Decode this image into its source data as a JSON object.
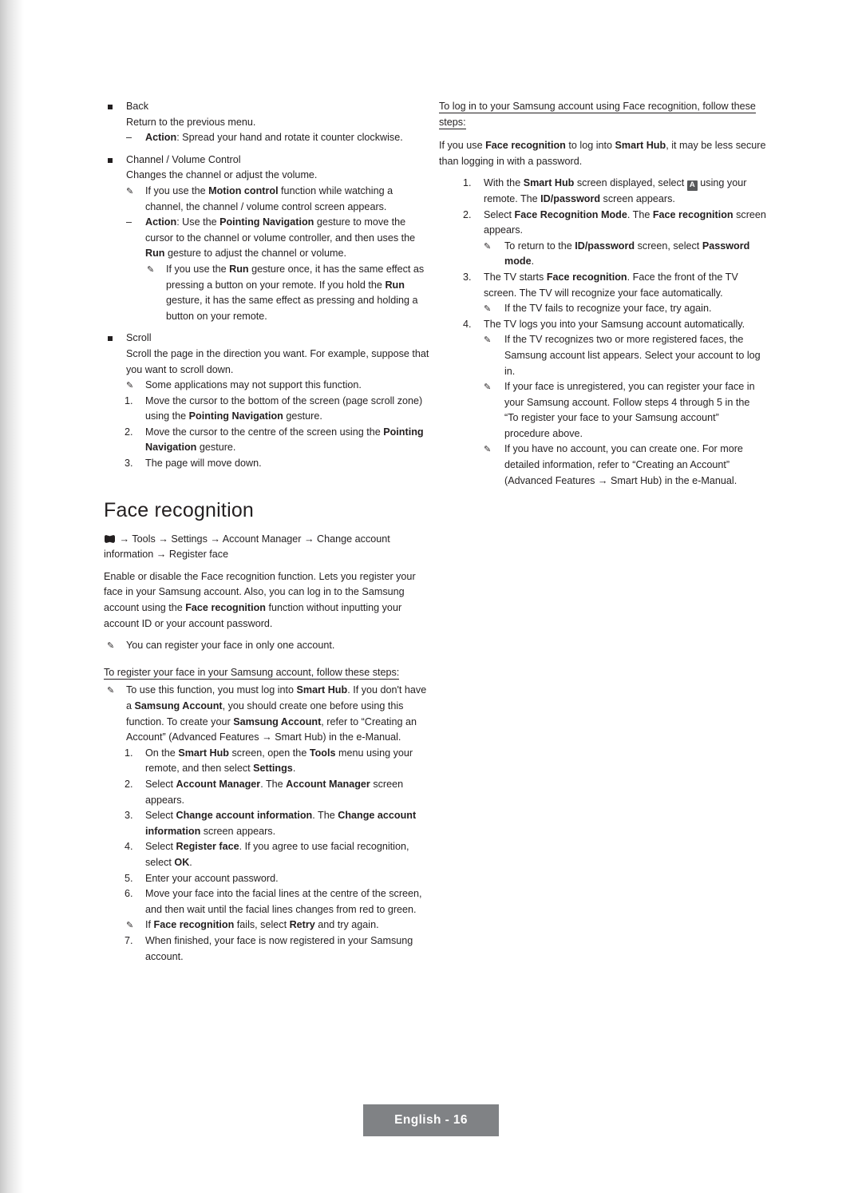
{
  "document": {
    "footer_label": "English - 16",
    "section_title": "Face recognition"
  },
  "left_column": {
    "items": [
      {
        "type": "square",
        "text": "Back"
      },
      {
        "type": "indent1",
        "text": "Return to the previous menu."
      },
      {
        "type": "dash",
        "bold_lead": "Action",
        "text": ": Spread your hand and rotate it counter clockwise."
      },
      {
        "type": "square",
        "text": "Channel / Volume Control"
      },
      {
        "type": "indent1",
        "text": "Changes the channel or adjust the volume."
      },
      {
        "type": "note",
        "text": "If you use the Motion control function while watching a channel, the channel / volume control screen appears."
      },
      {
        "type": "dash",
        "bold_lead": "Action",
        "text": ": Use the Pointing Navigation gesture to move the cursor to the channel or volume controller, and then uses the Run gesture to adjust the channel or volume."
      },
      {
        "type": "note-deep",
        "text": "If you use the Run gesture once, it has the same effect as pressing a button on your remote. If you hold the Run gesture, it has the same effect as pressing and holding a button on your remote."
      },
      {
        "type": "square",
        "text": "Scroll"
      },
      {
        "type": "indent1",
        "text": "Scroll the page in the direction you want. For example, suppose that you want to scroll down."
      },
      {
        "type": "note",
        "text": "Some applications may not support this function."
      },
      {
        "type": "num",
        "n": "1.",
        "text": "Move the cursor to the bottom of the screen (page scroll zone) using the Pointing Navigation gesture."
      },
      {
        "type": "num",
        "n": "2.",
        "text": "Move the cursor to the centre of the screen using the Pointing Navigation gesture."
      },
      {
        "type": "num",
        "n": "3.",
        "text": "The page will move down."
      }
    ],
    "face_recognition": {
      "title": "Face recognition",
      "menu_path": "→ Tools → Settings → Account Manager → Change account information → Register face",
      "intro": "Enable or disable the Face recognition function. Lets you register your face in your Samsung account. Also, you can log in to the Samsung account using the Face recognition function without inputting your account ID or your account password.",
      "note_one_account": "You can register your face in only one account.",
      "register_heading": "To register your face in your Samsung account, follow these steps:",
      "register_note": "To use this function, you must log into Smart Hub. If you don't have a Samsung Account, you should create one before using this function. To create your Samsung Account, refer to “Creating an Account” (Advanced Features → Smart Hub) in the e-Manual.",
      "steps": [
        {
          "n": "1.",
          "text": "On the Smart Hub screen, open the Tools menu using your remote, and then select Settings."
        },
        {
          "n": "2.",
          "text": "Select Account Manager. The Account Manager screen appears."
        },
        {
          "n": "3.",
          "text": "Select Change account information. The Change account information screen appears."
        },
        {
          "n": "4.",
          "text": "Select Register face. If you agree to use facial recognition, select OK."
        },
        {
          "n": "5.",
          "text": "Enter your account password."
        },
        {
          "n": "6.",
          "text": "Move your face into the facial lines at the centre of the screen, and then wait until the facial lines changes from red to green."
        },
        {
          "n": "6b-note",
          "text": "If Face recognition fails, select Retry and try again."
        },
        {
          "n": "7.",
          "text": "When finished, your face is now registered in your Samsung account."
        }
      ]
    }
  },
  "right_column": {
    "login_heading": "To log in to your Samsung account using Face recognition, follow these steps:",
    "login_intro": "If you use Face recognition to log into Smart Hub, it may be less secure than logging in with a password.",
    "steps": [
      {
        "n": "1.",
        "text": "With the Smart Hub screen displayed, select  using your remote. The ID/password screen appears.",
        "keycap": "A"
      },
      {
        "n": "2.",
        "text": "Select Face Recognition Mode. The Face recognition screen appears."
      },
      {
        "n": "2-note",
        "text": "To return to the ID/password screen, select Password mode."
      },
      {
        "n": "3.",
        "text": "The TV starts Face recognition. Face the front of the TV screen. The TV will recognize your face automatically."
      },
      {
        "n": "3-note",
        "text": "If the TV fails to recognize your face, try again."
      },
      {
        "n": "4.",
        "text": "The TV logs you into your Samsung account automatically."
      },
      {
        "n": "4-note-1",
        "text": "If the TV recognizes two or more registered faces, the Samsung account list appears. Select your account to log in."
      },
      {
        "n": "4-note-2",
        "text": "If your face is unregistered, you can register your face in your Samsung account. Follow steps 4 through 5 in the “To register your face to your Samsung account” procedure above."
      },
      {
        "n": "4-note-3",
        "text": "If you have no account, you can create one. For more detailed information, refer to “Creating an Account” (Advanced Features → Smart Hub) in the e-Manual."
      }
    ]
  },
  "icons": {
    "note_glyph": "✎",
    "dash_glyph": "–",
    "smart_hub_icon": "smart-hub-icon"
  }
}
